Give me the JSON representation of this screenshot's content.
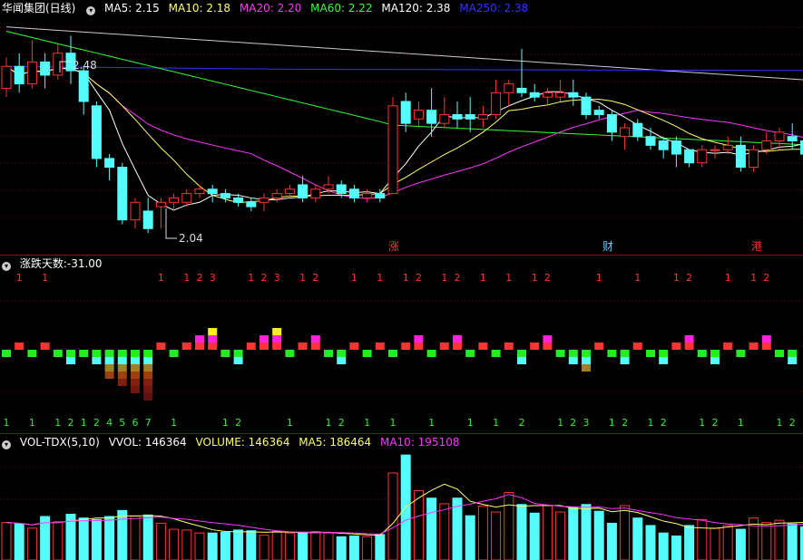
{
  "main": {
    "title": "华闻集团(日线)",
    "ma": [
      {
        "label": "MA5: 2.15",
        "color": "#ffffff"
      },
      {
        "label": "MA10: 2.18",
        "color": "#ffff66"
      },
      {
        "label": "MA20: 2.20",
        "color": "#ff33ff"
      },
      {
        "label": "MA60: 2.22",
        "color": "#33ff33"
      },
      {
        "label": "MA120: 2.38",
        "color": "#ffffff"
      },
      {
        "label": "MA250: 2.38",
        "color": "#3333ff"
      }
    ],
    "high_label": "2.48",
    "low_label": "2.04",
    "markers": [
      {
        "text": "涨",
        "color": "#ff3333"
      },
      {
        "text": "财",
        "color": "#66ccff"
      },
      {
        "text": "港",
        "color": "#ff3333"
      }
    ]
  },
  "streak": {
    "title": "涨跌天数",
    "value": ":-31.00"
  },
  "volume": {
    "title": "VOL-TDX(5,10)",
    "vvol": "VVOL: 146364",
    "volume": "VOLUME: 146364",
    "ma5": "MA5: 186464",
    "ma10": "MA10: 195108"
  },
  "chart_data": [
    {
      "type": "candlestick",
      "name": "price",
      "candles": [
        [
          2.36,
          2.41,
          2.34,
          2.43
        ],
        [
          2.41,
          2.37,
          2.35,
          2.44
        ],
        [
          2.37,
          2.42,
          2.36,
          2.47
        ],
        [
          2.42,
          2.39,
          2.36,
          2.44
        ],
        [
          2.39,
          2.44,
          2.38,
          2.46
        ],
        [
          2.44,
          2.4,
          2.37,
          2.48
        ],
        [
          2.4,
          2.33,
          2.3,
          2.41
        ],
        [
          2.32,
          2.2,
          2.18,
          2.33
        ],
        [
          2.2,
          2.18,
          2.15,
          2.21
        ],
        [
          2.18,
          2.06,
          2.05,
          2.19
        ],
        [
          2.06,
          2.1,
          2.04,
          2.11
        ],
        [
          2.08,
          2.04,
          2.03,
          2.11
        ],
        [
          2.09,
          2.1,
          2.04,
          2.11
        ],
        [
          2.1,
          2.11,
          2.08,
          2.12
        ],
        [
          2.1,
          2.12,
          2.09,
          2.13
        ],
        [
          2.12,
          2.13,
          2.11,
          2.14
        ],
        [
          2.13,
          2.12,
          2.1,
          2.14
        ],
        [
          2.12,
          2.11,
          2.1,
          2.13
        ],
        [
          2.11,
          2.1,
          2.09,
          2.12
        ],
        [
          2.1,
          2.09,
          2.08,
          2.11
        ],
        [
          2.1,
          2.11,
          2.08,
          2.12
        ],
        [
          2.11,
          2.12,
          2.1,
          2.13
        ],
        [
          2.12,
          2.13,
          2.11,
          2.14
        ],
        [
          2.14,
          2.11,
          2.1,
          2.16
        ],
        [
          2.11,
          2.13,
          2.1,
          2.14
        ],
        [
          2.13,
          2.14,
          2.12,
          2.16
        ],
        [
          2.14,
          2.12,
          2.11,
          2.15
        ],
        [
          2.13,
          2.11,
          2.1,
          2.14
        ],
        [
          2.11,
          2.12,
          2.1,
          2.13
        ],
        [
          2.12,
          2.11,
          2.1,
          2.13
        ],
        [
          2.12,
          2.32,
          2.12,
          2.34
        ],
        [
          2.33,
          2.28,
          2.26,
          2.35
        ],
        [
          2.29,
          2.31,
          2.27,
          2.33
        ],
        [
          2.31,
          2.28,
          2.25,
          2.36
        ],
        [
          2.28,
          2.3,
          2.27,
          2.34
        ],
        [
          2.3,
          2.29,
          2.27,
          2.33
        ],
        [
          2.3,
          2.29,
          2.26,
          2.34
        ],
        [
          2.29,
          2.3,
          2.27,
          2.32
        ],
        [
          2.3,
          2.35,
          2.29,
          2.38
        ],
        [
          2.35,
          2.37,
          2.32,
          2.38
        ],
        [
          2.36,
          2.35,
          2.34,
          2.45
        ],
        [
          2.35,
          2.34,
          2.33,
          2.37
        ],
        [
          2.34,
          2.35,
          2.32,
          2.36
        ],
        [
          2.34,
          2.35,
          2.33,
          2.38
        ],
        [
          2.35,
          2.34,
          2.32,
          2.38
        ],
        [
          2.34,
          2.3,
          2.29,
          2.35
        ],
        [
          2.31,
          2.3,
          2.29,
          2.32
        ],
        [
          2.3,
          2.26,
          2.24,
          2.31
        ],
        [
          2.25,
          2.27,
          2.22,
          2.28
        ],
        [
          2.28,
          2.25,
          2.24,
          2.29
        ],
        [
          2.25,
          2.23,
          2.22,
          2.27
        ],
        [
          2.24,
          2.22,
          2.2,
          2.25
        ],
        [
          2.24,
          2.21,
          2.18,
          2.25
        ],
        [
          2.22,
          2.19,
          2.18,
          2.22
        ],
        [
          2.19,
          2.22,
          2.18,
          2.23
        ],
        [
          2.22,
          2.22,
          2.2,
          2.23
        ],
        [
          2.22,
          2.23,
          2.21,
          2.25
        ],
        [
          2.23,
          2.18,
          2.17,
          2.25
        ],
        [
          2.18,
          2.22,
          2.17,
          2.23
        ],
        [
          2.22,
          2.24,
          2.21,
          2.26
        ],
        [
          2.24,
          2.26,
          2.22,
          2.27
        ],
        [
          2.25,
          2.24,
          2.22,
          2.28
        ],
        [
          2.24,
          2.21,
          2.2,
          2.25
        ]
      ]
    },
    {
      "type": "bar",
      "name": "涨跌天数",
      "values": [
        -1,
        1,
        -1,
        1,
        -1,
        -2,
        -1,
        -2,
        -4,
        -5,
        -6,
        -7,
        1,
        -1,
        1,
        2,
        3,
        -1,
        -2,
        1,
        2,
        3,
        -1,
        1,
        2,
        -1,
        -2,
        1,
        -1,
        1,
        -1,
        1,
        2,
        -1,
        1,
        2,
        -1,
        1,
        -1,
        1,
        -2,
        1,
        2,
        -1,
        -2,
        -3,
        1,
        -1,
        -2,
        1,
        -1,
        -2,
        1,
        2,
        -1,
        -2,
        1,
        -1,
        1,
        2,
        -1,
        -2
      ]
    },
    {
      "type": "bar",
      "name": "VOL-TDX(5,10)",
      "values": [
        100,
        96,
        85,
        116,
        102,
        122,
        112,
        108,
        116,
        132,
        118,
        120,
        98,
        82,
        80,
        72,
        72,
        74,
        80,
        78,
        66,
        76,
        72,
        74,
        76,
        72,
        62,
        64,
        62,
        68,
        232,
        280,
        185,
        165,
        150,
        165,
        118,
        144,
        128,
        180,
        148,
        125,
        145,
        128,
        140,
        148,
        130,
        98,
        145,
        112,
        92,
        72,
        64,
        92,
        108,
        85,
        92,
        82,
        112,
        100,
        106,
        96,
        88
      ]
    }
  ]
}
